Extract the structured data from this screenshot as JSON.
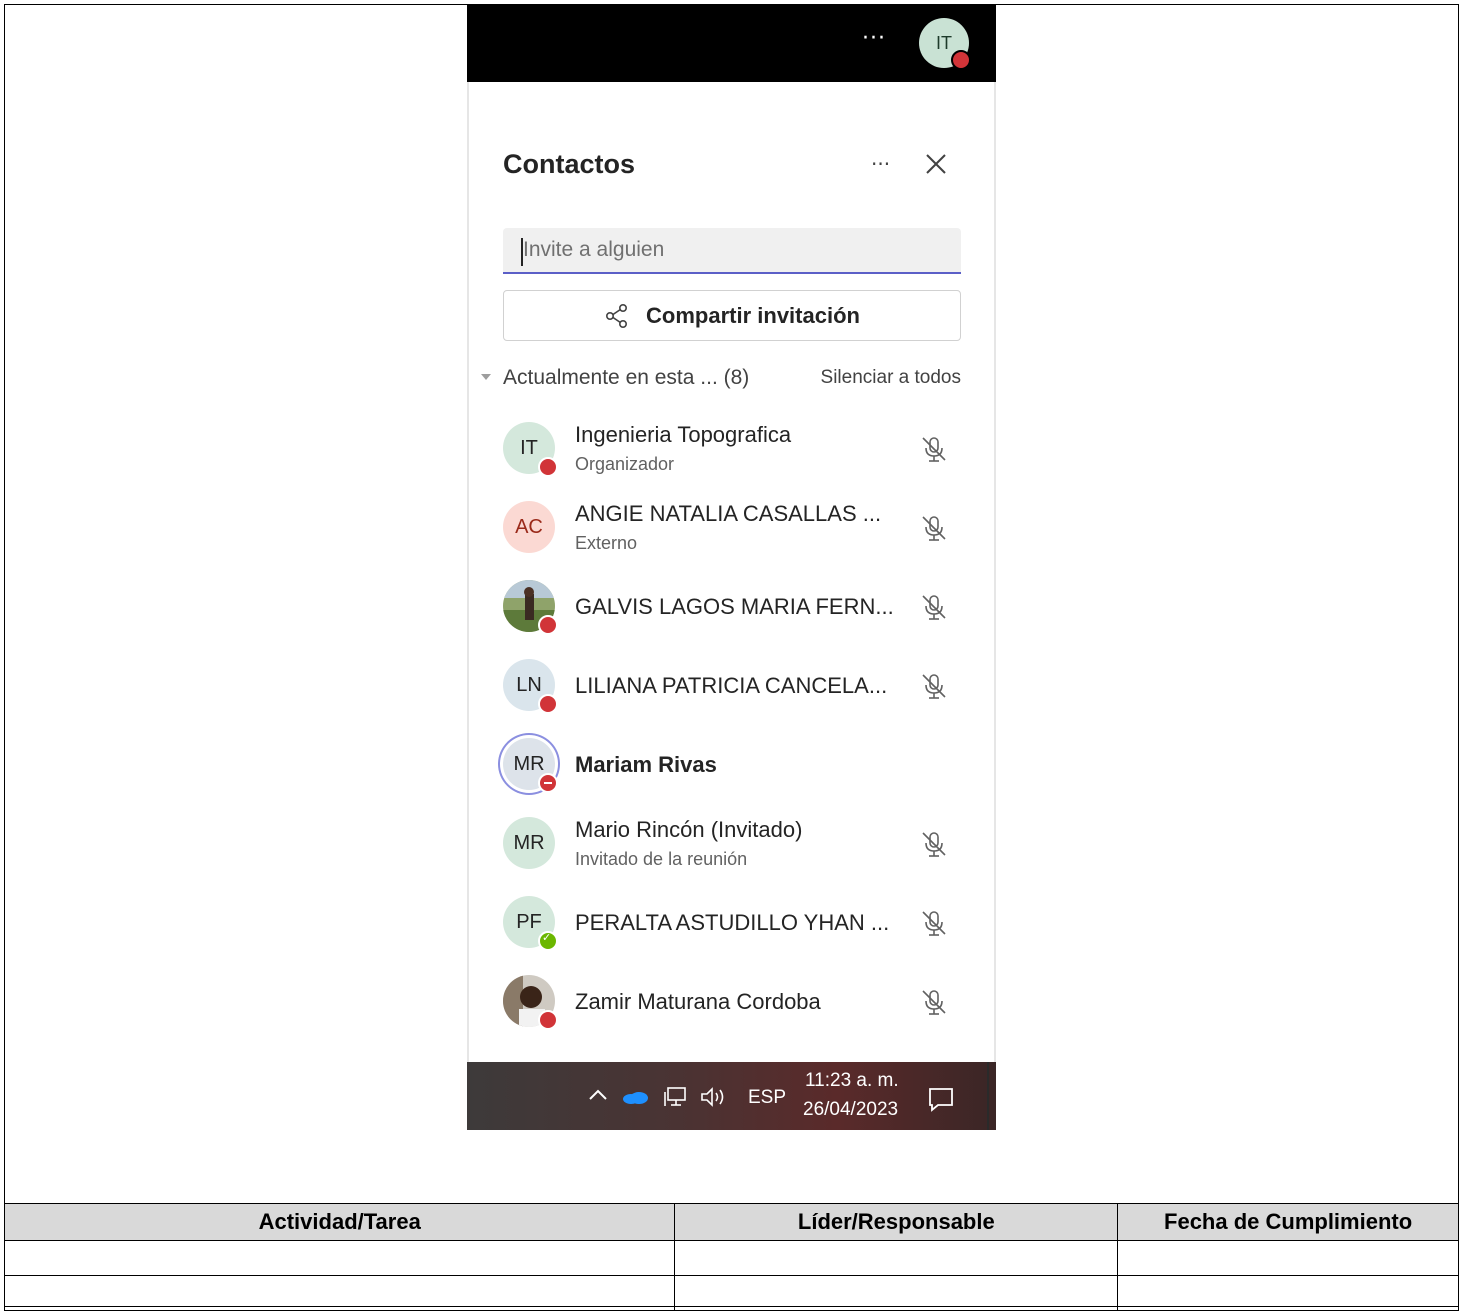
{
  "topbar": {
    "more_label": "···",
    "avatar_initials": "IT"
  },
  "panel": {
    "title": "Contactos",
    "more_label": "···",
    "search_placeholder": "Invite a alguien",
    "share_label": "Compartir invitación",
    "section_label": "Actualmente en esta ... (8)",
    "mute_all_label": "Silenciar a todos"
  },
  "participants": [
    {
      "initials": "IT",
      "name": "Ingenieria Topografica",
      "subtitle": "Organizador",
      "status": "busy",
      "avatar_color": "#d4e8dc"
    },
    {
      "initials": "AC",
      "name": "ANGIE NATALIA CASALLAS ...",
      "subtitle": "Externo",
      "status": "none",
      "avatar_color": "#fbd9d3"
    },
    {
      "initials": "",
      "name": "GALVIS LAGOS MARIA FERN...",
      "subtitle": "",
      "status": "busy",
      "avatar_color": "#7d8c5a"
    },
    {
      "initials": "LN",
      "name": "LILIANA PATRICIA CANCELA...",
      "subtitle": "",
      "status": "busy",
      "avatar_color": "#dae5ec"
    },
    {
      "initials": "MR",
      "name": "Mariam Rivas",
      "subtitle": "",
      "status": "dnd",
      "avatar_color": "#dde3ea"
    },
    {
      "initials": "MR",
      "name": "Mario Rincón (Invitado)",
      "subtitle": "Invitado de la reunión",
      "status": "none",
      "avatar_color": "#d4e8dc"
    },
    {
      "initials": "PF",
      "name": "PERALTA ASTUDILLO YHAN ...",
      "subtitle": "",
      "status": "available",
      "avatar_color": "#d4e8dc"
    },
    {
      "initials": "",
      "name": "Zamir Maturana Cordoba",
      "subtitle": "",
      "status": "busy",
      "avatar_color": "#5a4a3a"
    }
  ],
  "taskbar": {
    "language": "ESP",
    "time": "11:23 a. m.",
    "date": "26/04/2023"
  },
  "table": {
    "headers": [
      "Actividad/Tarea",
      "Líder/Responsable",
      "Fecha de Cumplimiento"
    ]
  },
  "colors": {
    "accent": "#5b5fc7",
    "busy": "#d13438",
    "available": "#6bb700"
  }
}
